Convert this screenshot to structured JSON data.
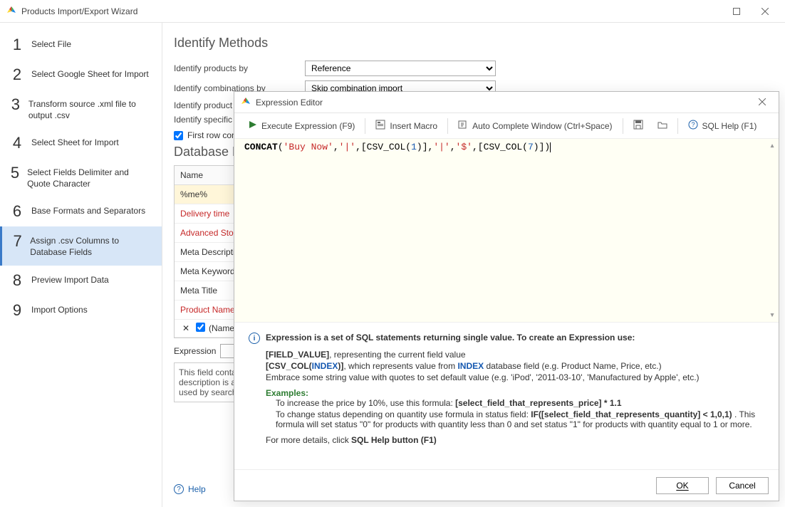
{
  "window": {
    "title": "Products Import/Export Wizard"
  },
  "sidebar": {
    "steps": [
      {
        "num": "1",
        "label": "Select File"
      },
      {
        "num": "2",
        "label": "Select Google Sheet for Import"
      },
      {
        "num": "3",
        "label": "Transform source .xml file to output .csv"
      },
      {
        "num": "4",
        "label": "Select Sheet for Import"
      },
      {
        "num": "5",
        "label": "Select Fields Delimiter and Quote Character"
      },
      {
        "num": "6",
        "label": "Base Formats and Separators"
      },
      {
        "num": "7",
        "label": "Assign .csv Columns to Database Fields"
      },
      {
        "num": "8",
        "label": "Preview Import Data"
      },
      {
        "num": "9",
        "label": "Import Options"
      }
    ],
    "active_index": 6
  },
  "content": {
    "identify_title": "Identify Methods",
    "rows": [
      {
        "label": "Identify products by",
        "value": "Reference"
      },
      {
        "label": "Identify combinations by",
        "value": "Skip combination import"
      }
    ],
    "partial_rows": [
      "Identify product",
      "Identify specific"
    ],
    "first_row_check": {
      "checked": true,
      "label": "First row con"
    },
    "db_title": "Database F",
    "table": {
      "header": "Name",
      "rows": [
        {
          "text": "%me%",
          "cls": "selected"
        },
        {
          "text": "Delivery time",
          "cls": "red"
        },
        {
          "text": "Advanced Stock",
          "cls": "red"
        },
        {
          "text": "Meta Description",
          "cls": ""
        },
        {
          "text": "Meta Keywords",
          "cls": ""
        },
        {
          "text": "Meta Title",
          "cls": ""
        },
        {
          "text": "Product Name",
          "cls": "red"
        }
      ],
      "subrow_label": "(Name"
    },
    "expr_label": "Expression",
    "hint": "This field contain\ndescription is a \nused by search e",
    "help_label": "Help"
  },
  "dialog": {
    "title": "Expression Editor",
    "toolbar": {
      "execute": "Execute Expression (F9)",
      "insert_macro": "Insert Macro",
      "autocomplete": "Auto Complete Window (Ctrl+Space)",
      "sql_help": "SQL Help (F1)"
    },
    "expression_tokens": [
      {
        "t": "CONCAT",
        "c": "kw"
      },
      {
        "t": "(",
        "c": "brk"
      },
      {
        "t": "'Buy Now'",
        "c": "str"
      },
      {
        "t": ",",
        "c": "brk"
      },
      {
        "t": "'|'",
        "c": "str"
      },
      {
        "t": ",",
        "c": "brk"
      },
      {
        "t": "[CSV_COL(",
        "c": "col"
      },
      {
        "t": "1",
        "c": "num"
      },
      {
        "t": ")]",
        "c": "col"
      },
      {
        "t": ",",
        "c": "brk"
      },
      {
        "t": "'|'",
        "c": "str"
      },
      {
        "t": ",",
        "c": "brk"
      },
      {
        "t": "'$'",
        "c": "str"
      },
      {
        "t": ",",
        "c": "brk"
      },
      {
        "t": "[CSV_COL(",
        "c": "col"
      },
      {
        "t": "7",
        "c": "num"
      },
      {
        "t": ")]",
        "c": "col"
      },
      {
        "t": ")",
        "c": "brk"
      }
    ],
    "help": {
      "lead": "Expression is a set of SQL statements returning single value. To create an Expression use:",
      "fv_bold": "[FIELD_VALUE]",
      "fv_rest": ", representing the current field value",
      "csv_pre": "[CSV_COL(",
      "csv_idx": "INDEX",
      "csv_close": ")]",
      "csv_mid": ", which represents value from ",
      "csv_idx2": "INDEX",
      "csv_rest": " database field (e.g. Product Name, Price, etc.)",
      "embrace": "Embrace some string value with quotes to set default value (e.g. 'iPod', '2011-03-10', 'Manufactured by Apple', etc.)",
      "examples_label": "Examples:",
      "ex1_pre": "To increase the price by 10%, use this formula: ",
      "ex1_bold": "[select_field_that_represents_price] * 1.1",
      "ex2_pre": "To change status depending on quantity use formula in status field: ",
      "ex2_bold": "IF([select_field_that_represents_quantity] < 1,0,1)",
      "ex2_post": " . This formula will set status \"0\" for products with quantity less than 0 and set status \"1\" for products with quantity equal to 1 or more.",
      "footer_pre": "For more details, click ",
      "footer_bold": "SQL Help button (F1)"
    },
    "buttons": {
      "ok": "OK",
      "cancel": "Cancel"
    }
  }
}
